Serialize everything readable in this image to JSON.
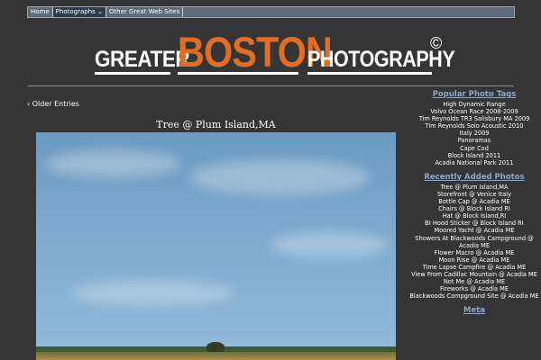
{
  "nav": {
    "items": [
      {
        "label": "Home"
      },
      {
        "label": "Photographs ⌄"
      },
      {
        "label": "Other Great Web Sites"
      }
    ]
  },
  "logo": {
    "greater": "GREATER",
    "boston": "BOSTON",
    "photography": "PHOTOGRAPHY",
    "copyright": "©"
  },
  "main": {
    "older_entries": "‹ Older Entries",
    "post_title": "Tree @ Plum Island,MA"
  },
  "sidebar": {
    "popular_heading": "Popular Photo Tags",
    "popular_tags": [
      "High Dynamic Range",
      "Volvo Ocean Race 2008-2009",
      "Tim Reynolds TR3 Salisbury MA 2009",
      "Tim Reynolds Solo Acoustic 2010",
      "Italy 2009",
      "Panoramas",
      "Cape Cod",
      "Block Island 2011",
      "Acadia National Park 2011"
    ],
    "recent_heading": "Recently Added Photos",
    "recent_photos": [
      "Tree @ Plum Island,MA",
      "Storefront @ Venice Italy",
      "Bottle Cap @ Acadia ME",
      "Chairs @ Block Island RI",
      "Hat @ Block Island,RI",
      "BI Hood Sticker @ Block Island RI",
      "Moored Yacht @ Acadia ME",
      "Showers At Blackwoods Campground @ Acadia ME",
      "Flower Macro @ Acadia ME",
      "Moon Rise @ Acadia ME",
      "Time Lapse Campfire @ Acadia ME",
      "View From Cadillac Mountain @ Acadia ME",
      "Not Me @ Acadia ME",
      "Fireworks @ Acadia ME",
      "Blackwoods Campground Site @ Acadia ME"
    ],
    "meta_heading": "Meta"
  }
}
